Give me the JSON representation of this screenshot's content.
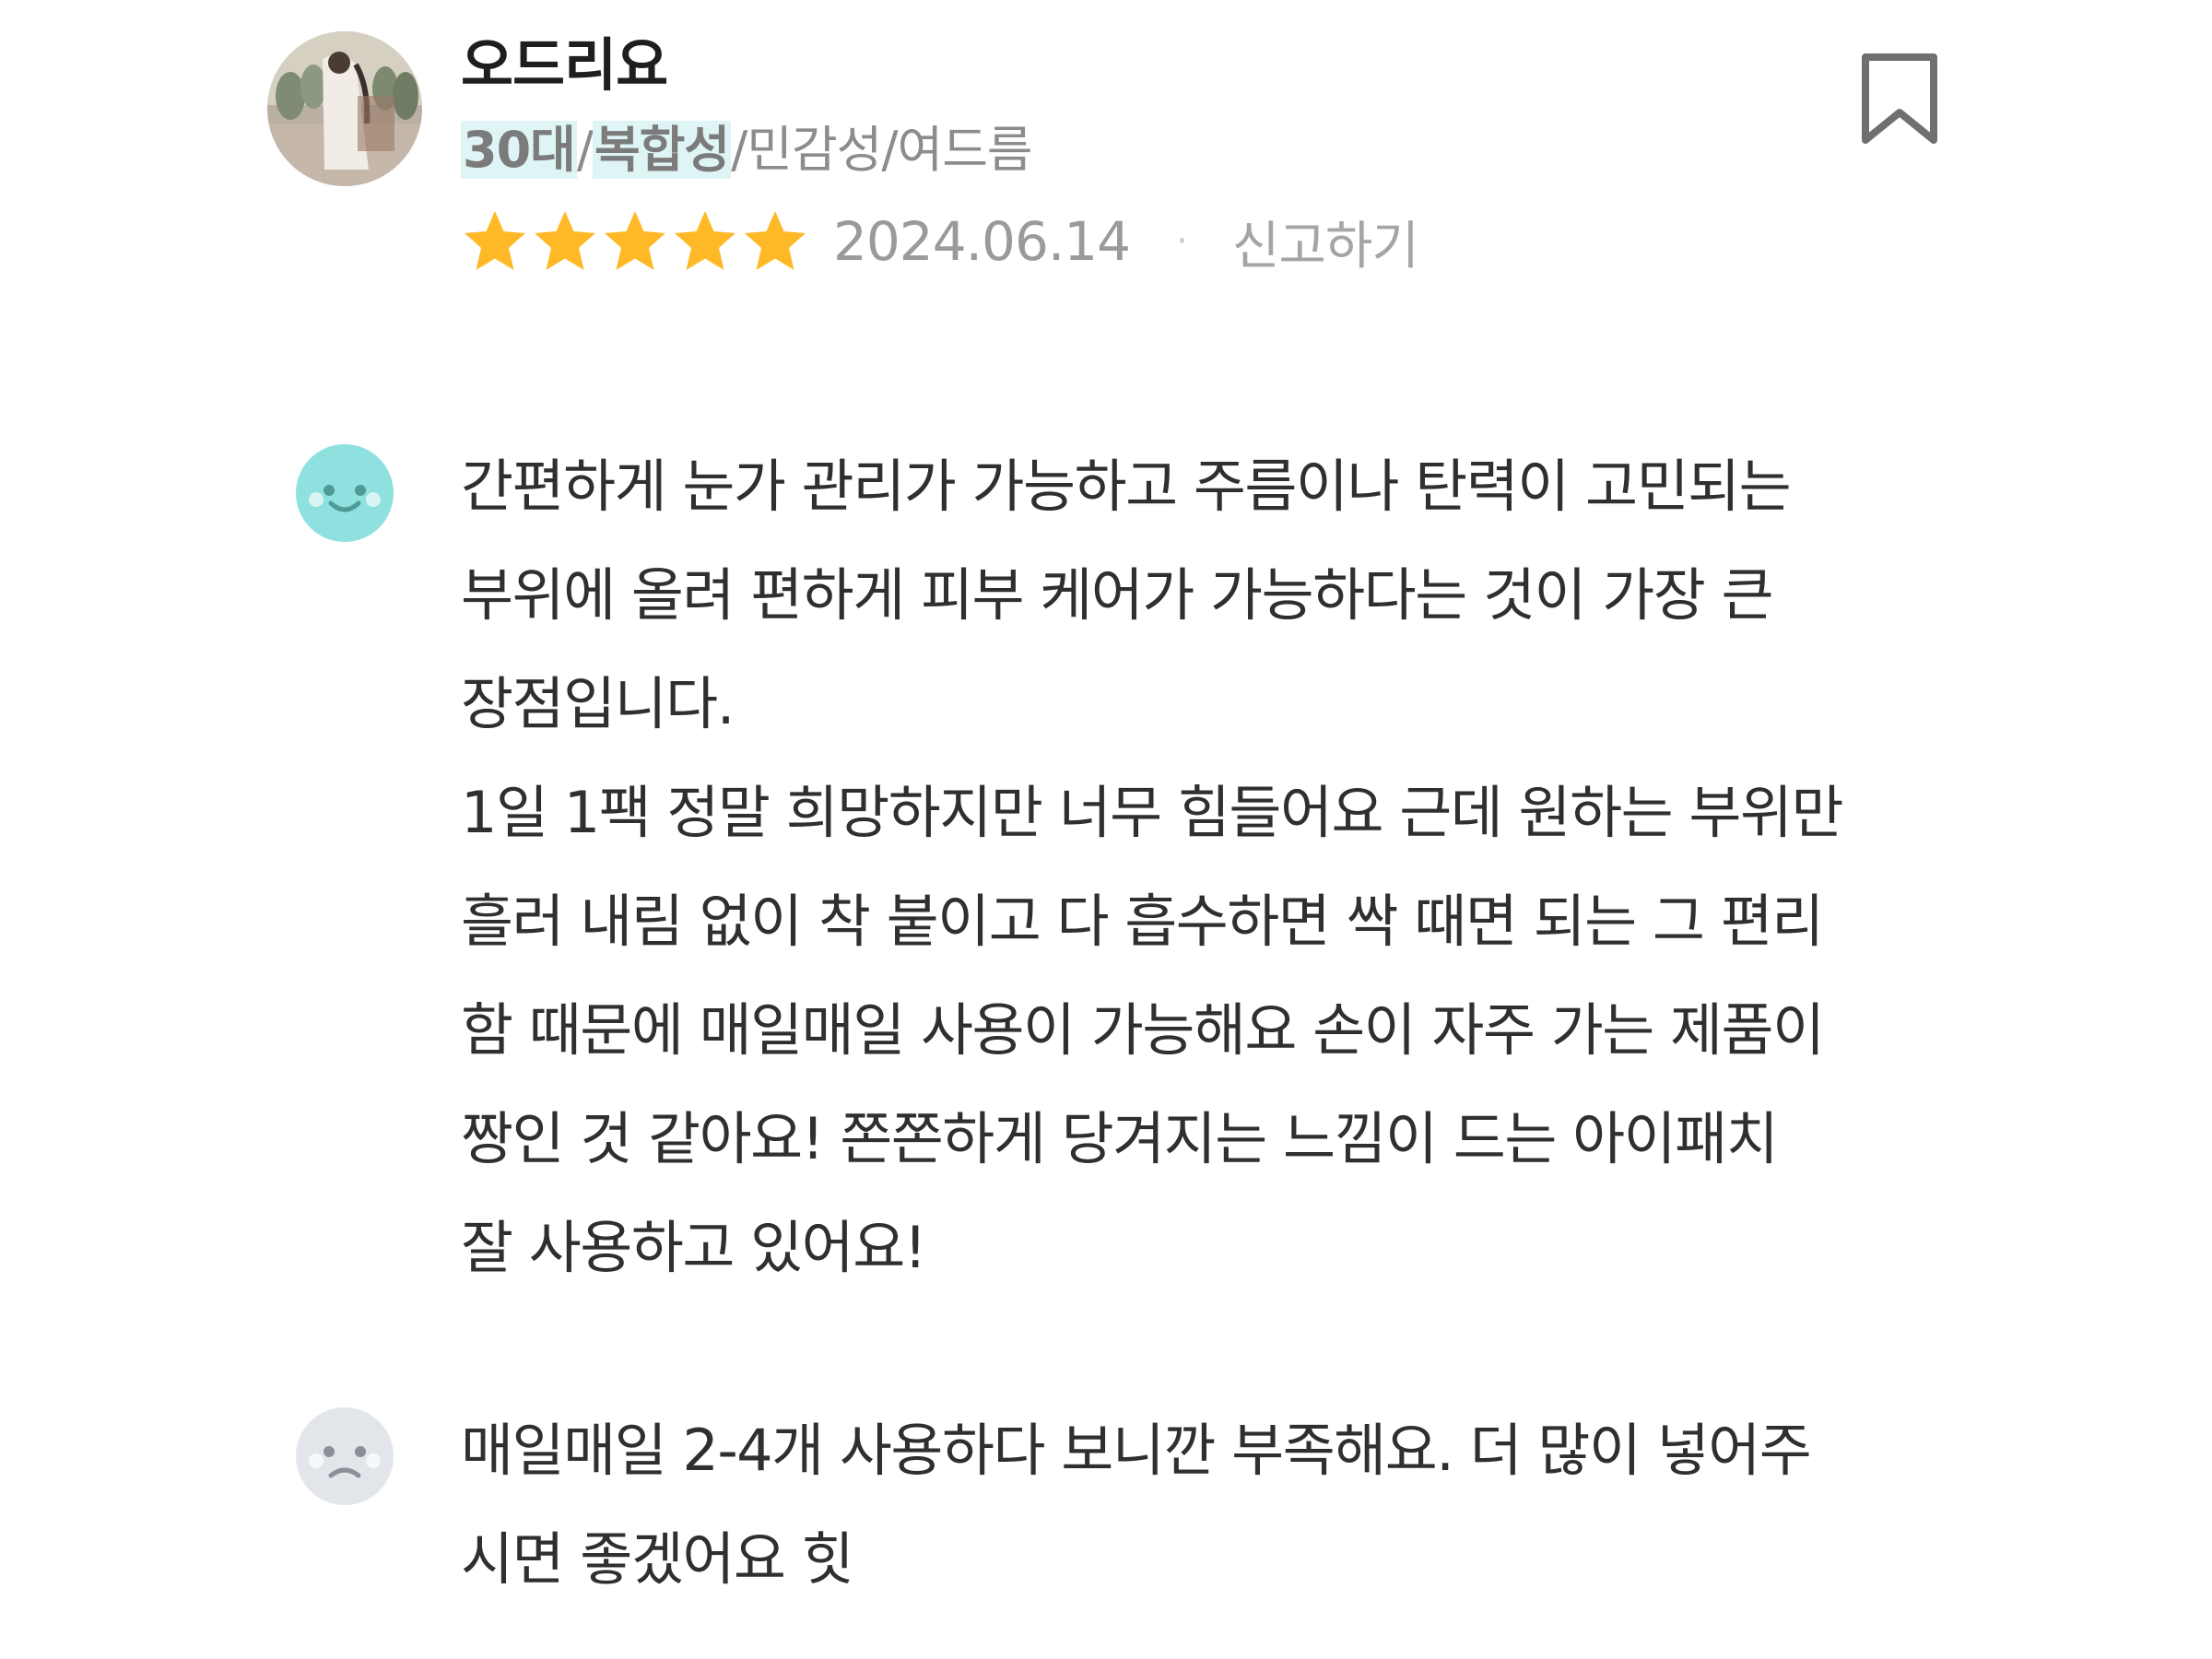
{
  "reviewer": {
    "nickname": "오드리요",
    "tags": [
      "30대",
      "복합성",
      "민감성",
      "여드름"
    ],
    "highlighted_tag_count": 2
  },
  "rating": {
    "stars": 5,
    "max_stars": 5,
    "date": "2024.06.14",
    "separator": "·",
    "report_label": "신고하기"
  },
  "icons": {
    "star_color": "#ffb927",
    "good_face_color": "#8fe1df",
    "bad_face_color": "#e2e6ea",
    "bookmark_color": "#6f6f6f"
  },
  "good_section": {
    "icon": "smile-face-icon",
    "lines": [
      "간편하게 눈가 관리가 가능하고 주름이나 탄력이 고민되는",
      "부위에 올려 편하게 피부 케어가 가능하다는 것이 가장 큰",
      "장점입니다.",
      "1일 1팩 정말 희망하지만 너무 힘들어요 근데 원하는 부위만",
      "흘러 내림 없이 착 붙이고 다 흡수하면 싹 때면 되는 그 편리",
      "함 때문에 매일매일 사용이 가능해요 손이 자주 가는 제품이",
      "짱인 것 같아요! 쫀쫀하게 당겨지는 느낌이 드는 아이패치",
      "잘 사용하고 있어요!"
    ]
  },
  "bad_section": {
    "icon": "sad-face-icon",
    "lines": [
      "매일매일 2-4개 사용하다 보니깐 부족해요. 더 많이 넣어주",
      "시면 좋겠어요 힛"
    ]
  }
}
